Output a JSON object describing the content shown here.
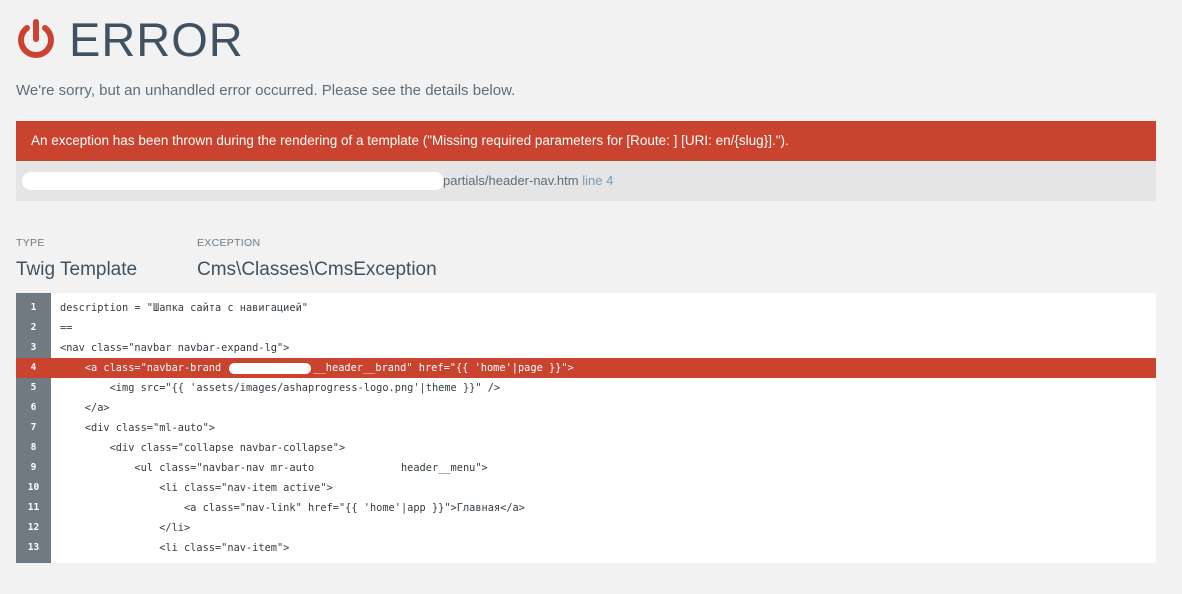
{
  "header": {
    "icon": "power-icon",
    "title": "ERROR",
    "subtitle": "We're sorry, but an unhandled error occurred. Please see the details below."
  },
  "alert": {
    "message": "An exception has been thrown during the rendering of a template (\"Missing required parameters for [Route: ] [URI: en/{slug}].\")."
  },
  "source": {
    "path": "partials/header-nav.htm",
    "line_label": "line 4"
  },
  "details": {
    "type_label": "TYPE",
    "type_value": "Twig Template",
    "exception_label": "EXCEPTION",
    "exception_value": "Cms\\Classes\\CmsException"
  },
  "code": {
    "highlight_line": 4,
    "lines": [
      {
        "num": "1",
        "before": "description = \"Шапка сайта с навигацией\"",
        "after": ""
      },
      {
        "num": "2",
        "before": "==",
        "after": ""
      },
      {
        "num": "3",
        "before": "<nav class=\"navbar navbar-expand-lg\">",
        "after": ""
      },
      {
        "num": "4",
        "before": "    <a class=\"navbar-brand ",
        "after": "__header__brand\" href=\"{{ 'home'|page }}\">"
      },
      {
        "num": "5",
        "before": "        <img src=\"{{ 'assets/images/ashaprogress-logo.png'|theme }}\" />",
        "after": ""
      },
      {
        "num": "6",
        "before": "    </a>",
        "after": ""
      },
      {
        "num": "7",
        "before": "    <div class=\"ml-auto\">",
        "after": ""
      },
      {
        "num": "8",
        "before": "        <div class=\"collapse navbar-collapse\">",
        "after": ""
      },
      {
        "num": "9",
        "before": "            <ul class=\"navbar-nav mr-auto              header__menu\">",
        "after": ""
      },
      {
        "num": "10",
        "before": "                <li class=\"nav-item active\">",
        "after": ""
      },
      {
        "num": "11",
        "before": "                    <a class=\"nav-link\" href=\"{{ 'home'|app }}\">Главная</a>",
        "after": ""
      },
      {
        "num": "12",
        "before": "                </li>",
        "after": ""
      },
      {
        "num": "13",
        "before": "                <li class=\"nav-item\">",
        "after": ""
      }
    ]
  },
  "colors": {
    "accent": "#c9432f",
    "text": "#405261",
    "background": "#f2f2f2",
    "gutter": "#6f7a82"
  }
}
